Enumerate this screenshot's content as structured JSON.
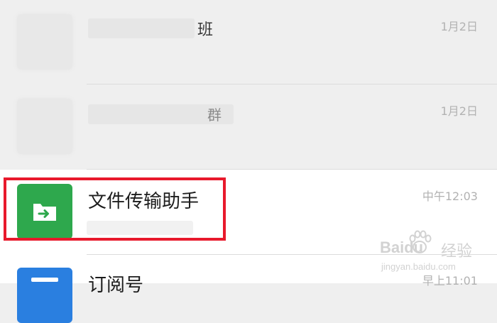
{
  "chats": [
    {
      "name": "班",
      "preview": "",
      "time": "1月2日"
    },
    {
      "name": "群",
      "preview": "",
      "time": "1月2日"
    },
    {
      "name": "文件传输助手",
      "preview": "",
      "time": "中午12:03"
    },
    {
      "name": "订阅号",
      "preview": "",
      "time": "早上11:01"
    }
  ],
  "watermark": {
    "brand": "Baidu",
    "cn": "经验",
    "url": "jingyan.baidu.com"
  },
  "colors": {
    "highlight": "#e8192c",
    "file_transfer": "#2ea84d",
    "subscription": "#2a7fe0"
  }
}
